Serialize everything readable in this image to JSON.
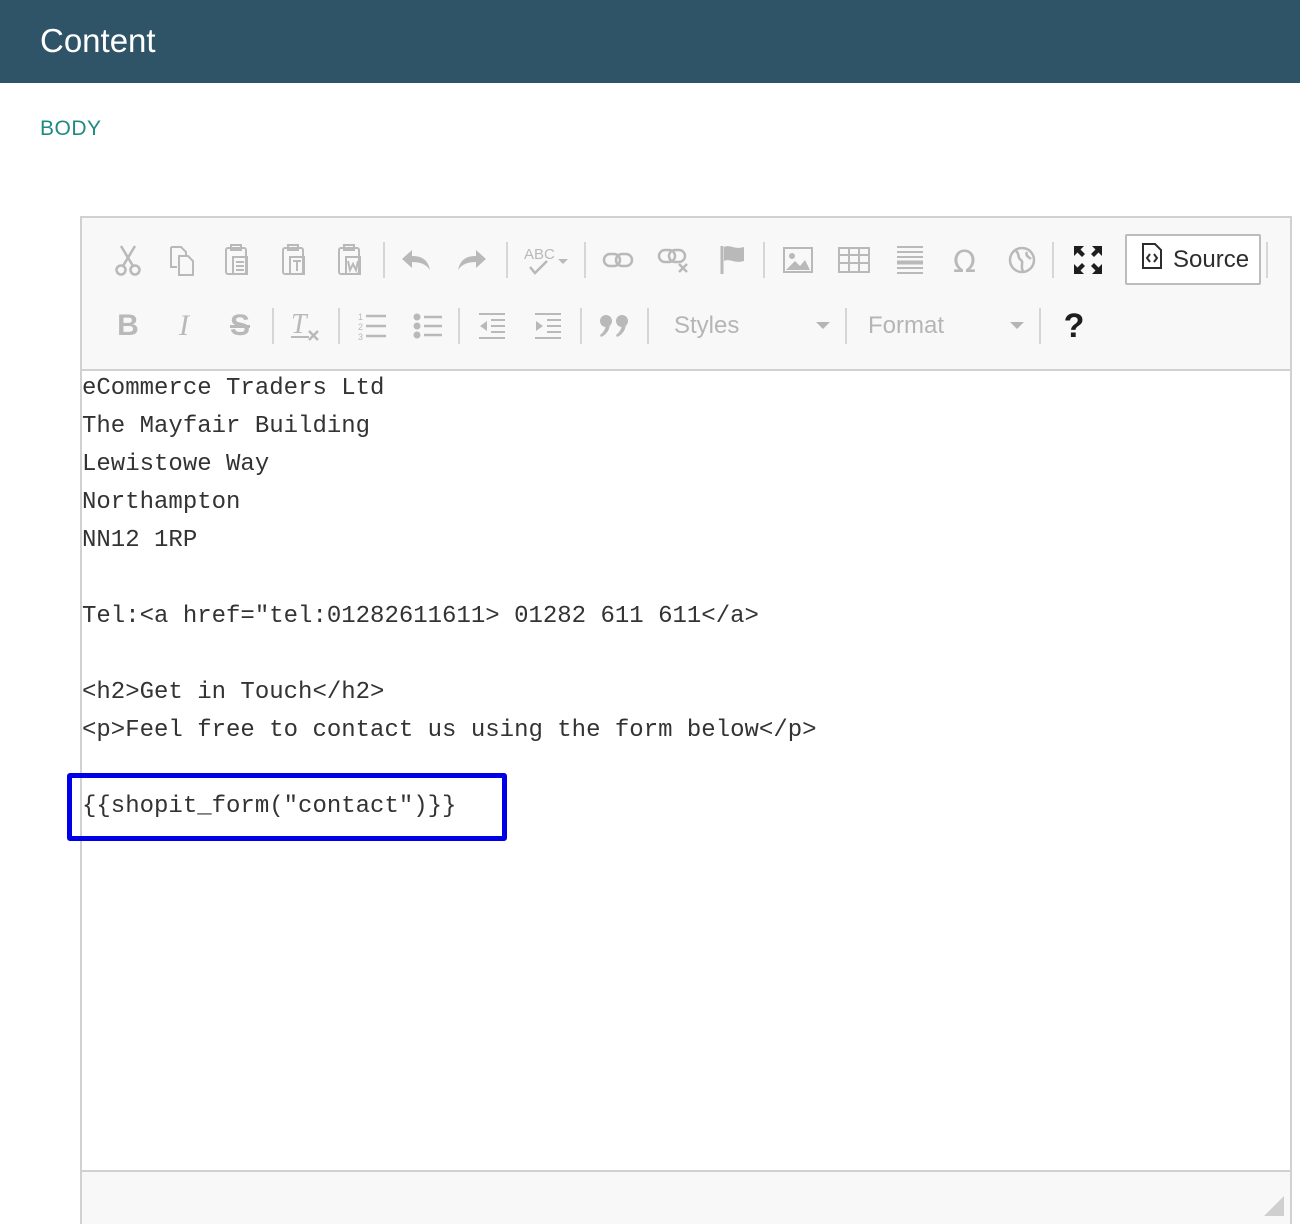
{
  "header": {
    "title": "Content"
  },
  "section": {
    "label": "BODY"
  },
  "toolbar": {
    "source_label": "Source",
    "styles_label": "Styles",
    "format_label": "Format",
    "help_label": "?",
    "bold_label": "B",
    "italic_label": "I",
    "strike_label": "S",
    "icons": [
      "cut-icon",
      "copy-icon",
      "paste-icon",
      "paste-text-icon",
      "paste-word-icon",
      "undo-icon",
      "redo-icon",
      "spellcheck-icon",
      "link-icon",
      "unlink-icon",
      "anchor-icon",
      "image-icon",
      "table-icon",
      "horizontal-rule-icon",
      "special-char-icon",
      "iframe-icon",
      "maximize-icon",
      "source-icon",
      "bold-icon",
      "italic-icon",
      "strike-icon",
      "remove-format-icon",
      "numbered-list-icon",
      "bulleted-list-icon",
      "outdent-icon",
      "indent-icon",
      "blockquote-icon",
      "help-icon"
    ]
  },
  "editor": {
    "lines": [
      "eCommerce Traders Ltd",
      "The Mayfair Building",
      "Lewistowe Way",
      "Northampton",
      "NN12 1RP",
      "",
      "Tel:<a href=\"tel:01282611611> 01282 611 611</a>",
      "",
      "<h2>Get in Touch</h2>",
      "<p>Feel free to contact us using the form below</p>",
      "",
      "{{shopit_form(\"contact\")}}"
    ]
  },
  "colors": {
    "header_bg": "#2f5467",
    "label_accent": "#1f8a84",
    "highlight_border": "#0000e6"
  }
}
